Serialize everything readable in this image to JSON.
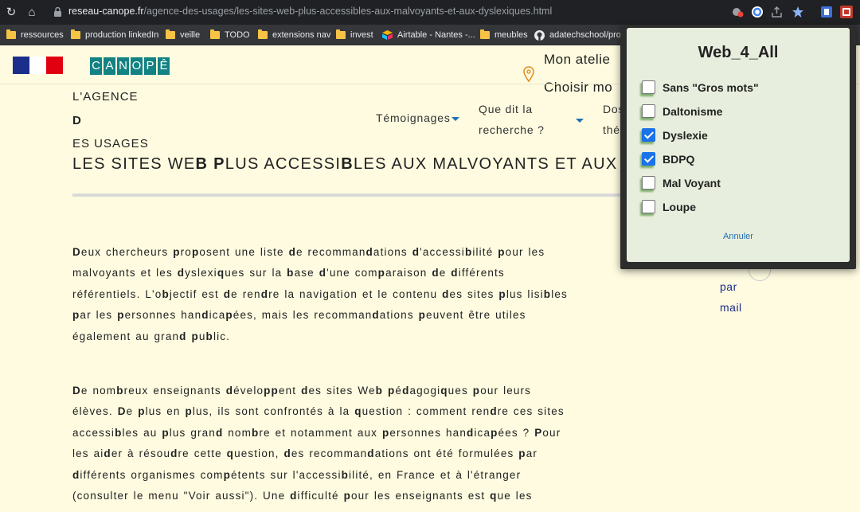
{
  "browser": {
    "url_host": "reseau-canope.fr",
    "url_path": "/agence-des-usages/les-sites-web-plus-accessibles-aux-malvoyants-et-aux-dyslexiques.html",
    "bookmarks": [
      {
        "label": "ressources",
        "icon": "folder-icon"
      },
      {
        "label": "production linkedIn",
        "icon": "folder-icon"
      },
      {
        "label": "veille",
        "icon": "folder-icon"
      },
      {
        "label": "TODO",
        "icon": "folder-icon"
      },
      {
        "label": "extensions nav",
        "icon": "folder-icon"
      },
      {
        "label": "invest",
        "icon": "folder-icon"
      },
      {
        "label": "Airtable - Nantes -...",
        "icon": "airtable-icon"
      },
      {
        "label": "meubles",
        "icon": "folder-icon"
      },
      {
        "label": "adatechschool/proj...",
        "icon": "github-icon"
      }
    ]
  },
  "header": {
    "logo_letters": [
      "C",
      "A",
      "N",
      "O",
      "P",
      "Ê"
    ],
    "atelier": "Mon atelie",
    "choisir": "Choisir mo",
    "agence_line1": "L'AGENCE",
    "agence_line2": "D",
    "agence_line3": "ES USAGES",
    "nav": {
      "temoignages": "Témoignages",
      "recherche_line1": "Que dit la",
      "recherche_line2": "recherche ?",
      "dossiers_line1": "Dos",
      "dossiers_line2": "thé"
    }
  },
  "article": {
    "title_parts": [
      "LES SITES WE",
      "B",
      " ",
      "P",
      "LUS ACCESSI",
      "B",
      "LES AUX MALVOYANTS ET AUX"
    ],
    "side_links": [
      "par",
      "mail"
    ]
  },
  "popup": {
    "title": "Web_4_All",
    "options": [
      {
        "label": "Sans \"Gros mots\"",
        "checked": false
      },
      {
        "label": "Daltonisme",
        "checked": false
      },
      {
        "label": "Dyslexie",
        "checked": true
      },
      {
        "label": "BDPQ",
        "checked": true
      },
      {
        "label": "Mal Voyant",
        "checked": false
      },
      {
        "label": "Loupe",
        "checked": false
      }
    ],
    "cancel": "Annuler"
  },
  "colors": {
    "page_bg": "#fefbe0",
    "canope_teal": "#138283",
    "popup_bg": "#e8eedd",
    "link_blue": "#1f6fb3"
  }
}
